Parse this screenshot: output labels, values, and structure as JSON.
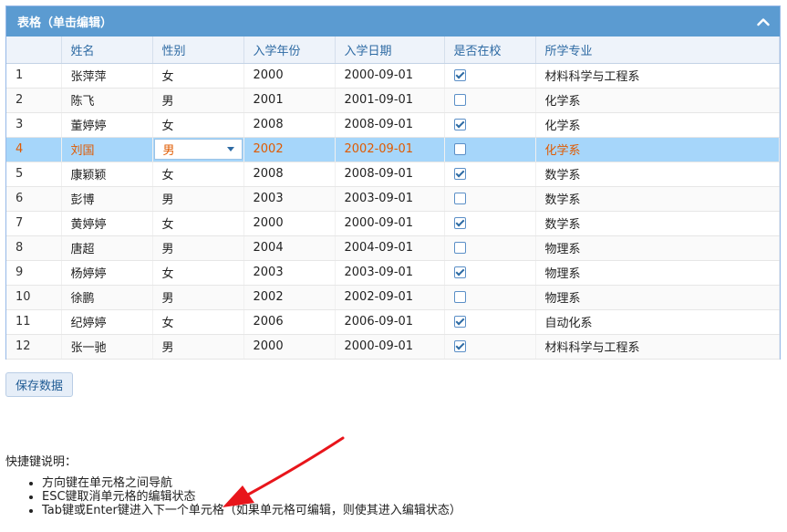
{
  "panel": {
    "title": "表格（单击编辑）",
    "collapse_icon": "chevron-up-icon"
  },
  "columns": [
    "",
    "姓名",
    "性别",
    "入学年份",
    "入学日期",
    "是否在校",
    "所学专业"
  ],
  "rows": [
    {
      "num": "1",
      "name": "张萍萍",
      "gender": "女",
      "year": "2000",
      "date": "2000-09-01",
      "enrolled": true,
      "major": "材料科学与工程系"
    },
    {
      "num": "2",
      "name": "陈飞",
      "gender": "男",
      "year": "2001",
      "date": "2001-09-01",
      "enrolled": false,
      "major": "化学系"
    },
    {
      "num": "3",
      "name": "董婷婷",
      "gender": "女",
      "year": "2008",
      "date": "2008-09-01",
      "enrolled": true,
      "major": "化学系"
    },
    {
      "num": "4",
      "name": "刘国",
      "gender": "男",
      "year": "2002",
      "date": "2002-09-01",
      "enrolled": false,
      "major": "化学系",
      "selected": true,
      "editing": "gender"
    },
    {
      "num": "5",
      "name": "康颖颖",
      "gender": "女",
      "year": "2008",
      "date": "2008-09-01",
      "enrolled": true,
      "major": "数学系"
    },
    {
      "num": "6",
      "name": "彭博",
      "gender": "男",
      "year": "2003",
      "date": "2003-09-01",
      "enrolled": false,
      "major": "数学系"
    },
    {
      "num": "7",
      "name": "黄婷婷",
      "gender": "女",
      "year": "2000",
      "date": "2000-09-01",
      "enrolled": true,
      "major": "数学系"
    },
    {
      "num": "8",
      "name": "唐超",
      "gender": "男",
      "year": "2004",
      "date": "2004-09-01",
      "enrolled": false,
      "major": "物理系"
    },
    {
      "num": "9",
      "name": "杨婷婷",
      "gender": "女",
      "year": "2003",
      "date": "2003-09-01",
      "enrolled": true,
      "major": "物理系"
    },
    {
      "num": "10",
      "name": "徐鹏",
      "gender": "男",
      "year": "2002",
      "date": "2002-09-01",
      "enrolled": false,
      "major": "物理系"
    },
    {
      "num": "11",
      "name": "纪婷婷",
      "gender": "女",
      "year": "2006",
      "date": "2006-09-01",
      "enrolled": true,
      "major": "自动化系"
    },
    {
      "num": "12",
      "name": "张一驰",
      "gender": "男",
      "year": "2000",
      "date": "2000-09-01",
      "enrolled": true,
      "major": "材料科学与工程系"
    }
  ],
  "save_label": "保存数据",
  "help": {
    "title": "快捷键说明：",
    "items": [
      "方向键在单元格之间导航",
      "ESC键取消单元格的编辑状态",
      "Tab键或Enter键进入下一个单元格（如果单元格可编辑，则使其进入编辑状态）"
    ]
  },
  "colors": {
    "header": "#5b9bd1",
    "selected_row": "#a6d6fa",
    "selected_text": "#e05a00",
    "arrow": "#e8151b"
  }
}
